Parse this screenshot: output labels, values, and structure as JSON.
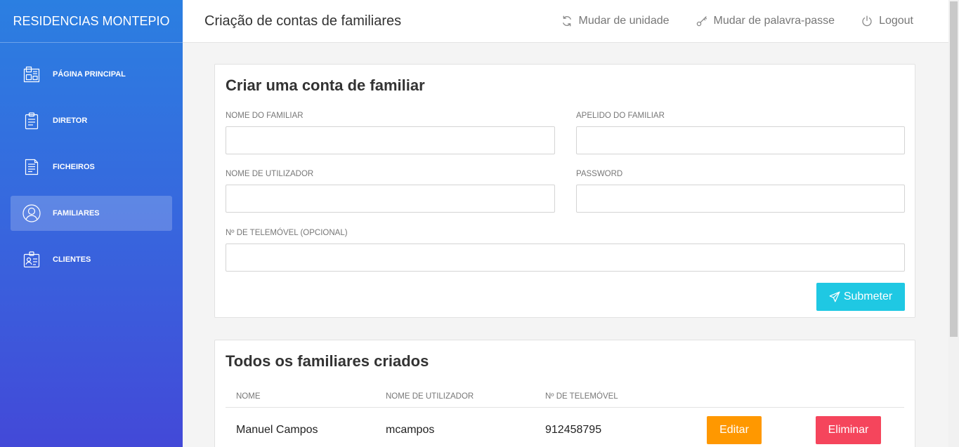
{
  "sidebar": {
    "brand": "RESIDENCIAS MONTEPIO",
    "items": [
      {
        "label": "PÁGINA PRINCIPAL",
        "icon": "dashboard-icon",
        "active": false
      },
      {
        "label": "DIRETOR",
        "icon": "clipboard-icon",
        "active": false
      },
      {
        "label": "FICHEIROS",
        "icon": "document-icon",
        "active": false
      },
      {
        "label": "FAMILIARES",
        "icon": "user-circle-icon",
        "active": true
      },
      {
        "label": "CLIENTES",
        "icon": "id-card-icon",
        "active": false
      }
    ]
  },
  "header": {
    "title": "Criação de contas de familiares",
    "actions": [
      {
        "label": "Mudar de unidade",
        "icon": "refresh-icon"
      },
      {
        "label": "Mudar de palavra-passe",
        "icon": "key-icon"
      },
      {
        "label": "Logout",
        "icon": "power-icon"
      }
    ]
  },
  "form": {
    "title": "Criar uma conta de familiar",
    "fields": {
      "first_name": {
        "label": "NOME DO FAMILIAR",
        "value": "",
        "placeholder": ""
      },
      "last_name": {
        "label": "APELIDO DO FAMILIAR",
        "value": "",
        "placeholder": ""
      },
      "username": {
        "label": "NOME DE UTILIZADOR",
        "value": "",
        "placeholder": ""
      },
      "password": {
        "label": "PASSWORD",
        "value": "",
        "placeholder": ""
      },
      "phone": {
        "label": "Nº DE TELEMÓVEL (OPCIONAL)",
        "value": "",
        "placeholder": ""
      }
    },
    "submit": {
      "label": "Submeter",
      "icon": "paper-plane-icon"
    }
  },
  "family_table": {
    "title": "Todos os familiares criados",
    "columns": [
      "NOME",
      "NOME DE UTILIZADOR",
      "Nº DE TELEMÓVEL"
    ],
    "rows": [
      {
        "name": "Manuel Campos",
        "username": "mcampos",
        "phone": "912458795",
        "edit_label": "Editar",
        "delete_label": "Eliminar"
      }
    ]
  },
  "colors": {
    "sidebar_top": "#2b7fe1",
    "sidebar_bottom": "#4349d8",
    "submit": "#1fc8e3",
    "edit": "#ff9800",
    "delete": "#f5455c"
  }
}
